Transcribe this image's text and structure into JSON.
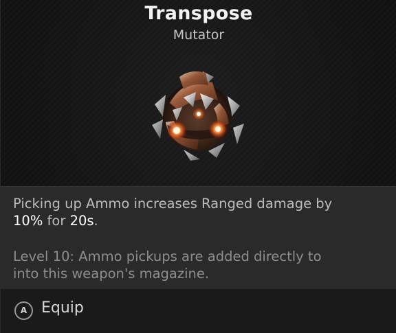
{
  "item": {
    "name": "Transpose",
    "type": "Mutator",
    "art_icon": "mutator-orb-icon"
  },
  "description": {
    "line1": "Picking up Ammo increases Ranged damage by",
    "line2_value1": "10%",
    "line2_joiner": " for ",
    "line2_value2": "20s",
    "line2_end": ".",
    "level_line1": "Level 10: Ammo pickups are added directly to",
    "level_line2": "into this weapon's magazine."
  },
  "footer": {
    "button_glyph": "A",
    "button_icon": "a-button-icon",
    "action_label": "Equip"
  },
  "colors": {
    "highlight": "#ffffff",
    "body_text": "#bdbdbd",
    "dim_text": "#8e8e8e"
  }
}
